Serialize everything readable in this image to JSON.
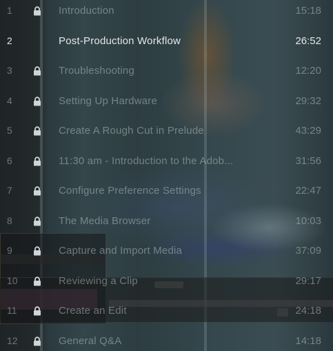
{
  "playlist": {
    "items": [
      {
        "number": "1",
        "title": "Introduction",
        "duration": "15:18",
        "locked": true,
        "active": false
      },
      {
        "number": "2",
        "title": "Post-Production Workflow",
        "duration": "26:52",
        "locked": false,
        "active": true
      },
      {
        "number": "3",
        "title": "Troubleshooting",
        "duration": "12:20",
        "locked": true,
        "active": false
      },
      {
        "number": "4",
        "title": "Setting Up Hardware",
        "duration": "29:32",
        "locked": true,
        "active": false
      },
      {
        "number": "5",
        "title": "Create A Rough Cut in Prelude",
        "duration": "43:29",
        "locked": true,
        "active": false
      },
      {
        "number": "6",
        "title": "11:30 am - Introduction to the Adob...",
        "duration": "31:56",
        "locked": true,
        "active": false
      },
      {
        "number": "7",
        "title": "Configure Preference Settings",
        "duration": "22:47",
        "locked": true,
        "active": false
      },
      {
        "number": "8",
        "title": "The Media Browser",
        "duration": "10:03",
        "locked": true,
        "active": false
      },
      {
        "number": "9",
        "title": "Capture and Import Media",
        "duration": "37:09",
        "locked": true,
        "active": false
      },
      {
        "number": "10",
        "title": "Reviewing a Clip",
        "duration": "29:17",
        "locked": true,
        "active": false
      },
      {
        "number": "11",
        "title": "Create an Edit",
        "duration": "24:18",
        "locked": true,
        "active": false
      },
      {
        "number": "12",
        "title": "General Q&A",
        "duration": "14:18",
        "locked": true,
        "active": false
      }
    ]
  },
  "colors": {
    "active_text": "#e4e7e8",
    "inactive_text": "rgba(175,185,188,0.55)",
    "lock_icon": "#cfd4d6"
  },
  "icons": {
    "lock": "lock-icon"
  }
}
